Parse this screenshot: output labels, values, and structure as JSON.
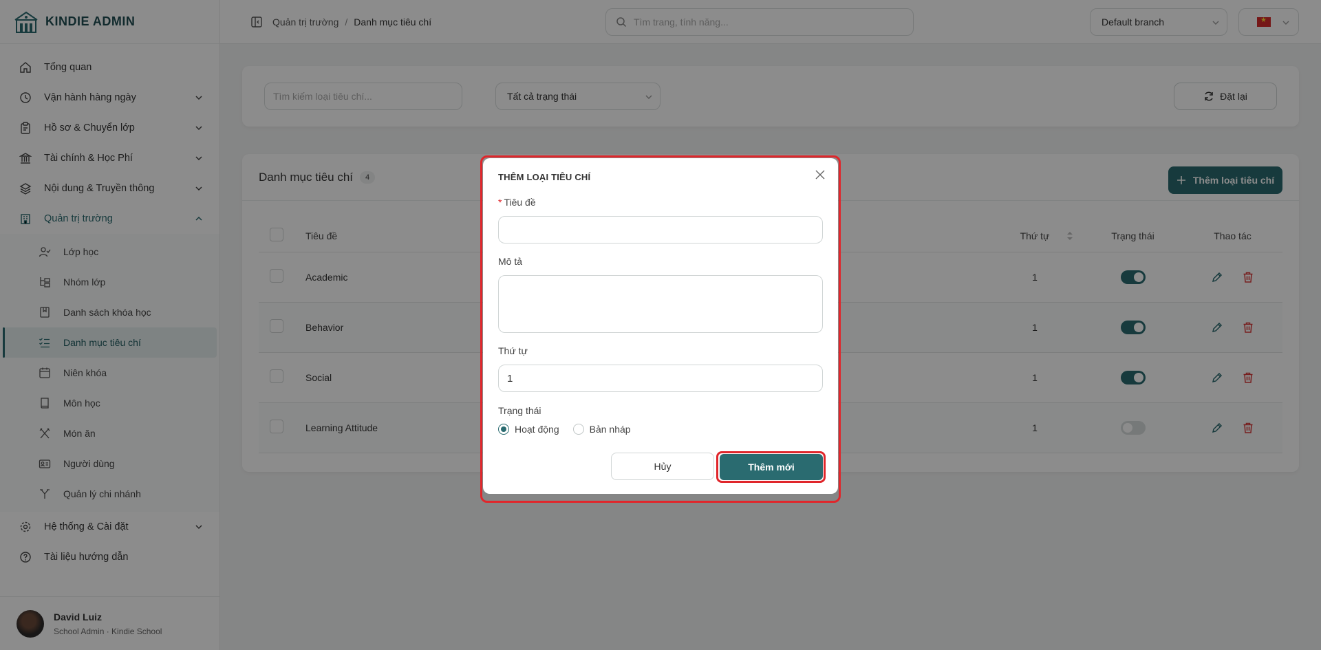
{
  "brand": {
    "name": "KINDIE ADMIN"
  },
  "sidebar": {
    "items": [
      {
        "label": "Tổng quan",
        "icon": "home-icon"
      },
      {
        "label": "Vận hành hàng ngày",
        "icon": "clock-icon"
      },
      {
        "label": "Hồ sơ & Chuyển lớp",
        "icon": "clipboard-icon"
      },
      {
        "label": "Tài chính & Học Phí",
        "icon": "bank-icon"
      },
      {
        "label": "Nội dung & Truyền thông",
        "icon": "layers-icon"
      },
      {
        "label": "Quản trị trường",
        "icon": "building-icon"
      }
    ],
    "sub_items": [
      {
        "label": "Lớp học",
        "icon": "user-check-icon"
      },
      {
        "label": "Nhóm lớp",
        "icon": "folder-tree-icon"
      },
      {
        "label": "Danh sách khóa học",
        "icon": "book-bookmark-icon"
      },
      {
        "label": "Danh mục tiêu chí",
        "icon": "list-check-icon"
      },
      {
        "label": "Niên khóa",
        "icon": "calendar-icon"
      },
      {
        "label": "Môn học",
        "icon": "book-icon"
      },
      {
        "label": "Món ăn",
        "icon": "utensils-icon"
      },
      {
        "label": "Người dùng",
        "icon": "id-card-icon"
      },
      {
        "label": "Quản lý chi nhánh",
        "icon": "branch-icon"
      }
    ],
    "bottom_items": [
      {
        "label": "Hệ thống & Cài đặt",
        "icon": "gear-icon"
      },
      {
        "label": "Tài liệu hướng dẫn",
        "icon": "help-icon"
      }
    ],
    "active_sub": "Danh mục tiêu chí"
  },
  "user": {
    "name": "David Luiz",
    "role": "School Admin · Kindie School"
  },
  "header": {
    "breadcrumb": [
      "Quản trị trường",
      "Danh mục tiêu chí"
    ],
    "breadcrumb_sep": "/",
    "search_placeholder": "Tìm trang, tính năng...",
    "branch": "Default branch"
  },
  "filters": {
    "search_placeholder": "Tìm kiếm loại tiêu chí...",
    "status_select": "Tất cả trạng thái",
    "reset_label": "Đặt lại"
  },
  "list": {
    "title": "Danh mục tiêu chí",
    "count": "4",
    "add_label": "Thêm loại tiêu chí",
    "columns": {
      "title": "Tiêu đề",
      "order": "Thứ tự",
      "status": "Trạng thái",
      "actions": "Thao tác"
    },
    "rows": [
      {
        "title": "Academic",
        "order": "1",
        "active": true
      },
      {
        "title": "Behavior",
        "order": "1",
        "active": true
      },
      {
        "title": "Social",
        "order": "1",
        "active": true
      },
      {
        "title": "Learning Attitude",
        "order": "1",
        "active": false
      }
    ]
  },
  "modal": {
    "title": "THÊM LOẠI TIÊU CHÍ",
    "title_label": "Tiêu đề",
    "required_mark": "*",
    "title_value": "",
    "desc_label": "Mô tả",
    "desc_value": "",
    "order_label": "Thứ tự",
    "order_value": "1",
    "status_label": "Trạng thái",
    "status_options": [
      "Hoạt động",
      "Bản nháp"
    ],
    "status_selected": "Hoạt động",
    "cancel_label": "Hủy",
    "submit_label": "Thêm mới"
  },
  "colors": {
    "primary": "#2a6b70",
    "highlight": "#e0262b",
    "danger": "#d93a3a"
  }
}
